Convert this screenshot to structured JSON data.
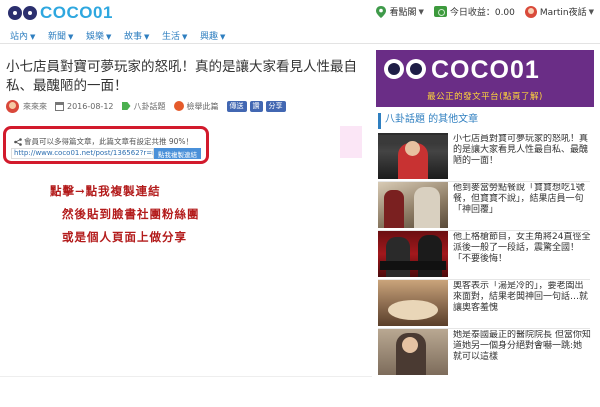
{
  "site": {
    "logo_text": "COCO01"
  },
  "topbar": {
    "location_label": "看點閣",
    "earnings_label": "今日收益：0.00",
    "user_label": "Martin夜話"
  },
  "nav": {
    "items": [
      {
        "label": "站內"
      },
      {
        "label": "新聞"
      },
      {
        "label": "娛樂"
      },
      {
        "label": "故事"
      },
      {
        "label": "生活"
      },
      {
        "label": "興趣"
      }
    ]
  },
  "article": {
    "title": "小七店員對寶可夢玩家的怒吼！真的是讓大家看見人性最自私、最醜陋的一面！",
    "author": "來來來",
    "date": "2016-08-12",
    "category": "八卦話題",
    "report_label": "檢舉此篇",
    "fb_share_label": "傳送",
    "fb_like_label": "讚",
    "fb_share2_label": "分享"
  },
  "share_box": {
    "notice": "會員可以多得篇文章，此篇文章有設定共推 90%！",
    "url": "http://www.coco01.net/post/136562?r=martin",
    "copy_button": "點我複製連結"
  },
  "annotation": {
    "lines": [
      "點擊→點我複製連結",
      "然後貼到臉書社團粉絲團",
      "或是個人頁面上做分享"
    ]
  },
  "sidebar": {
    "banner_logo": "COCO01",
    "banner_slogan": "最公正的發文平台(點頁了解)",
    "heading": "八卦話題 的其他文章",
    "articles": [
      {
        "text": "小七店員對寶可夢玩家的怒吼！真的是讓大家看見人性最自私、最醜陋的一面！"
      },
      {
        "text": "他到麥當勞點餐說「寶寶想吃1號餐，但寶寶不說」，結果店員一句「神回覆」"
      },
      {
        "text": "他上格槍節目，女主角將24直徑全派後一般了一段話，震驚全國！「不要後悔！"
      },
      {
        "text": "奧客表示「湯是冷的」，要老闆出來面對，結果老闆神回一句話…就讓奧客羞愧"
      },
      {
        "text": "她是泰國最正的醫院院長 但當你知道她另一個身分絕對會嚇一跳:她就可以這樣"
      }
    ]
  },
  "colors": {
    "accent_blue": "#2f7fc0",
    "banner_purple": "#6a2d86",
    "highlight_red": "#d21a2c",
    "annotation_red": "#b31b1b"
  }
}
